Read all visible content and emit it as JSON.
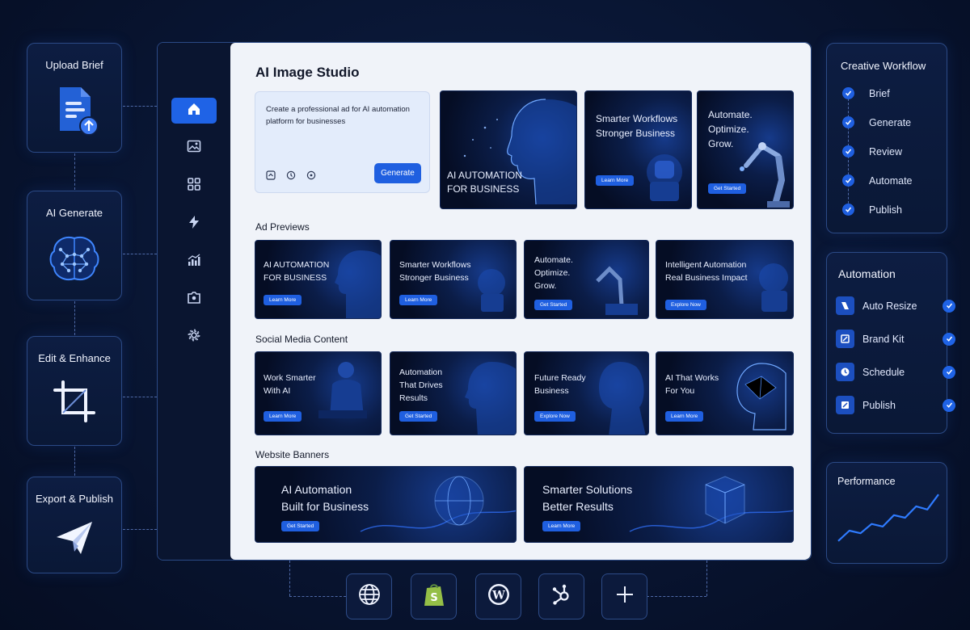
{
  "workflow_steps": [
    {
      "label": "Upload Brief",
      "icon": "document-upload-icon"
    },
    {
      "label": "AI Generate",
      "icon": "brain-icon"
    },
    {
      "label": "Edit & Enhance",
      "icon": "crop-icon"
    },
    {
      "label": "Export & Publish",
      "icon": "paper-plane-icon"
    }
  ],
  "app": {
    "title": "AI Image Studio",
    "sidebar": [
      "home-icon",
      "image-icon",
      "grid-icon",
      "lightning-icon",
      "analytics-icon",
      "camera-icon",
      "gear-icon"
    ],
    "prompt": {
      "text": "Create a professional ad for AI automation platform for businesses",
      "tools": [
        "image-upload-icon",
        "style-icon",
        "settings-dot-icon"
      ],
      "generate_label": "Generate"
    },
    "hero_tiles": [
      {
        "text": "AI AUTOMATION\nFOR BUSINESS"
      },
      {
        "text": "Smarter Workflows\nStronger Business",
        "button": "Learn More"
      },
      {
        "text": "Automate.\nOptimize.\nGrow.",
        "button": "Get Started"
      }
    ],
    "sections": {
      "ads": "Ad Previews",
      "social": "Social Media Content",
      "banners": "Website Banners"
    },
    "ad_previews": [
      {
        "text": "AI AUTOMATION\nFOR BUSINESS",
        "button": "Learn More"
      },
      {
        "text": "Smarter Workflows\nStronger Business",
        "button": "Learn More"
      },
      {
        "text": "Automate.\nOptimize.\nGrow.",
        "button": "Get Started"
      },
      {
        "text": "Intelligent Automation\nReal Business Impact",
        "button": "Explore Now"
      }
    ],
    "social": [
      {
        "text": "Work Smarter\nWith AI",
        "button": "Learn More"
      },
      {
        "text": "Automation\nThat Drives\nResults",
        "button": "Get Started"
      },
      {
        "text": "Future Ready\nBusiness",
        "button": "Explore Now"
      },
      {
        "text": "AI That Works\nFor You",
        "button": "Learn More"
      }
    ],
    "banners": [
      {
        "text": "AI Automation\nBuilt for Business",
        "button": "Get Started"
      },
      {
        "text": "Smarter Solutions\nBetter Results",
        "button": "Learn More"
      }
    ]
  },
  "creative_workflow": {
    "title": "Creative Workflow",
    "items": [
      "Brief",
      "Generate",
      "Review",
      "Automate",
      "Publish"
    ]
  },
  "automation": {
    "title": "Automation",
    "items": [
      {
        "label": "Auto Resize",
        "icon": "resize-icon"
      },
      {
        "label": "Brand Kit",
        "icon": "brand-kit-icon"
      },
      {
        "label": "Schedule",
        "icon": "clock-icon"
      },
      {
        "label": "Publish",
        "icon": "publish-icon"
      }
    ]
  },
  "performance": {
    "title": "Performance",
    "trend": [
      0.05,
      0.25,
      0.2,
      0.38,
      0.33,
      0.55,
      0.5,
      0.72,
      0.66,
      0.95
    ]
  },
  "integrations": [
    "globe-icon",
    "shopify-icon",
    "wordpress-icon",
    "hubspot-icon",
    "plus-icon"
  ],
  "colors": {
    "accent": "#1f5fe0",
    "background": "#081430",
    "content_bg": "#f0f3f9"
  }
}
